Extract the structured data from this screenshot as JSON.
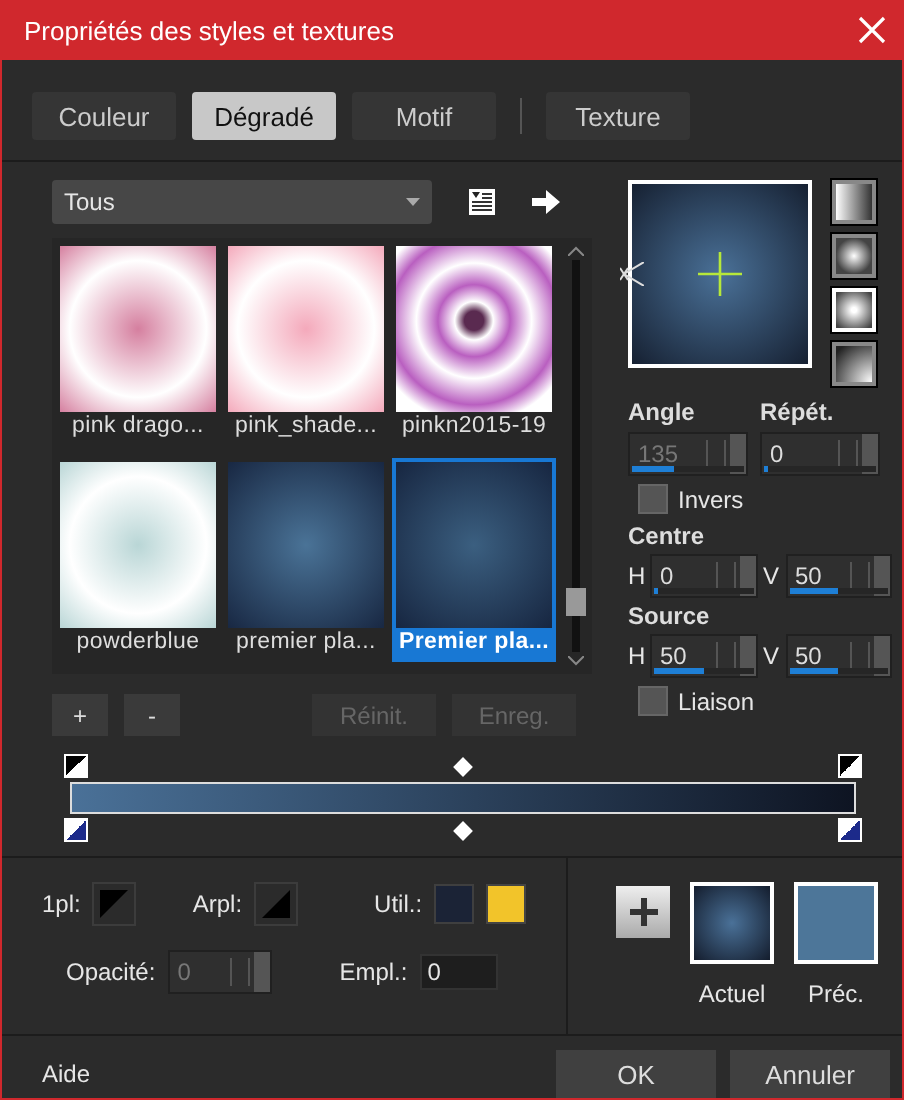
{
  "window": {
    "title": "Propriétés des styles et textures"
  },
  "tabs": [
    {
      "label": "Couleur",
      "selected": false
    },
    {
      "label": "Dégradé",
      "selected": true
    },
    {
      "label": "Motif",
      "selected": false
    },
    {
      "label": "Texture",
      "selected": false
    }
  ],
  "library": {
    "filter": "Tous",
    "items": [
      {
        "name": "pink drago...",
        "selected": false
      },
      {
        "name": "pink_shade...",
        "selected": false
      },
      {
        "name": "pinkn2015-19",
        "selected": false
      },
      {
        "name": "powderblue",
        "selected": false
      },
      {
        "name": "premier pla...",
        "selected": false
      },
      {
        "name": "Premier pla...",
        "selected": true
      }
    ]
  },
  "library_buttons": [
    {
      "label": "+",
      "disabled": false
    },
    {
      "label": "-",
      "disabled": false
    },
    {
      "label": "Réinit.",
      "disabled": true
    },
    {
      "label": "Enreg.",
      "disabled": true
    }
  ],
  "styles": [
    {
      "kind": "linear",
      "selected": false
    },
    {
      "kind": "rectangular",
      "selected": false
    },
    {
      "kind": "radial",
      "selected": true
    },
    {
      "kind": "corner",
      "selected": false
    }
  ],
  "angle": {
    "label": "Angle",
    "value": "135",
    "level": 0.37,
    "disabled": true
  },
  "repeat": {
    "label": "Répét.",
    "value": "0",
    "level": 0,
    "disabled": false
  },
  "invert": {
    "label": "Invers",
    "checked": false
  },
  "center": {
    "label": "Centre",
    "h": {
      "label": "H",
      "value": "0",
      "level": 0
    },
    "v": {
      "label": "V",
      "value": "50",
      "level": 0.5
    }
  },
  "source": {
    "label": "Source",
    "h": {
      "label": "H",
      "value": "50",
      "level": 0.5
    },
    "v": {
      "label": "V",
      "value": "50",
      "level": 0.5
    }
  },
  "link": {
    "label": "Liaison",
    "checked": false
  },
  "gradient_stops": [
    {
      "color": "#4a7198"
    },
    {
      "color": "#0e1422"
    }
  ],
  "stop_props": {
    "fg_label": "1pl:",
    "bg_label": "Arpl:",
    "user_label": "Util.:",
    "user_colors": [
      {
        "color": "#1b2336"
      },
      {
        "color": "#f2c42a"
      }
    ],
    "opacity_label": "Opacité:",
    "opacity_value": "0",
    "opacity_disabled": true,
    "location_label": "Empl.:",
    "location_value": "0"
  },
  "swatches": [
    {
      "label": "Actuel",
      "kind": "radial"
    },
    {
      "label": "Préc.",
      "kind": "flat",
      "color": "#4d7699"
    }
  ],
  "footer": {
    "help": "Aide",
    "buttons": [
      "OK",
      "Annuler"
    ]
  }
}
